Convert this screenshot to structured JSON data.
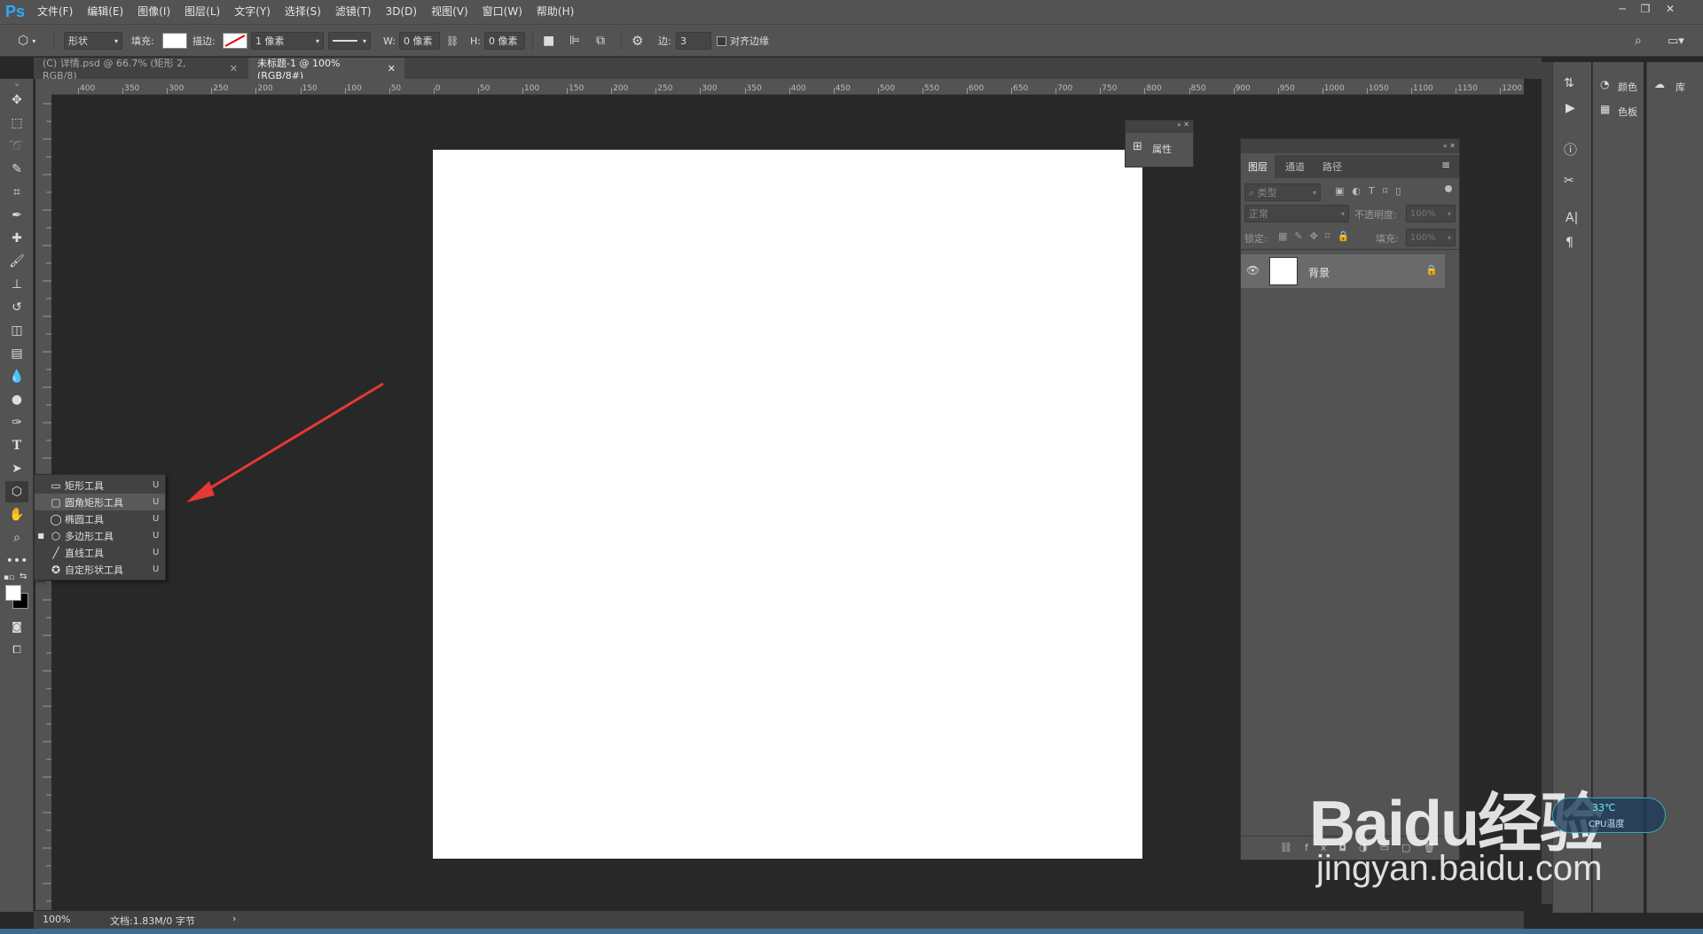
{
  "app": {
    "logo": "Ps"
  },
  "menu": [
    "文件(F)",
    "编辑(E)",
    "图像(I)",
    "图层(L)",
    "文字(Y)",
    "选择(S)",
    "滤镜(T)",
    "3D(D)",
    "视图(V)",
    "窗口(W)",
    "帮助(H)"
  ],
  "options": {
    "mode": "形状",
    "fill_label": "填充:",
    "stroke_label": "描边:",
    "stroke_width": "1 像素",
    "w_label": "W:",
    "w_value": "0 像素",
    "h_label": "H:",
    "h_value": "0 像素",
    "sides_label": "边:",
    "sides_value": "3",
    "align_edges": "对齐边缘"
  },
  "tabs": [
    {
      "label": "(C) 详情.psd @ 66.7% (矩形 2, RGB/8)"
    },
    {
      "label": "未标题-1 @ 100%(RGB/8#)"
    }
  ],
  "hruler_ticks": [
    "400",
    "350",
    "300",
    "250",
    "200",
    "150",
    "100",
    "50",
    "0",
    "50",
    "100",
    "150",
    "200",
    "250",
    "300",
    "350",
    "400",
    "450",
    "500",
    "550",
    "600",
    "650",
    "700",
    "750",
    "800",
    "850",
    "900",
    "950",
    "1000",
    "1050",
    "1100",
    "1150",
    "1200"
  ],
  "flyout": [
    {
      "label": "矩形工具",
      "key": "U",
      "icon": "rectangle-icon",
      "active": false
    },
    {
      "label": "圆角矩形工具",
      "key": "U",
      "icon": "rounded-rectangle-icon",
      "active": false
    },
    {
      "label": "椭圆工具",
      "key": "U",
      "icon": "ellipse-icon",
      "active": false
    },
    {
      "label": "多边形工具",
      "key": "U",
      "icon": "polygon-icon",
      "active": true
    },
    {
      "label": "直线工具",
      "key": "U",
      "icon": "line-icon",
      "active": false
    },
    {
      "label": "自定形状工具",
      "key": "U",
      "icon": "custom-shape-icon",
      "active": false
    }
  ],
  "properties_panel": {
    "label": "属性"
  },
  "layers_panel": {
    "tabs": [
      "图层",
      "通道",
      "路径"
    ],
    "filter_placeholder": "类型",
    "blend_mode": "正常",
    "opacity_label": "不透明度:",
    "opacity_value": "100%",
    "lock_label": "锁定:",
    "fill_label": "填充:",
    "fill_value": "100%",
    "layers": [
      {
        "name": "背景"
      }
    ]
  },
  "right_dock": {
    "color": "颜色",
    "swatches": "色板",
    "library": "库"
  },
  "status": {
    "zoom": "100%",
    "doc": "文档:1.83M/0 字节"
  },
  "watermark": {
    "brand": "Baidu经验",
    "url": "jingyan.baidu.com",
    "temp": "33℃",
    "temp_label": "CPU温度"
  },
  "colors": {
    "arrow": "#e53935",
    "ui_bg": "#535353",
    "canvas_bg": "#282828"
  }
}
